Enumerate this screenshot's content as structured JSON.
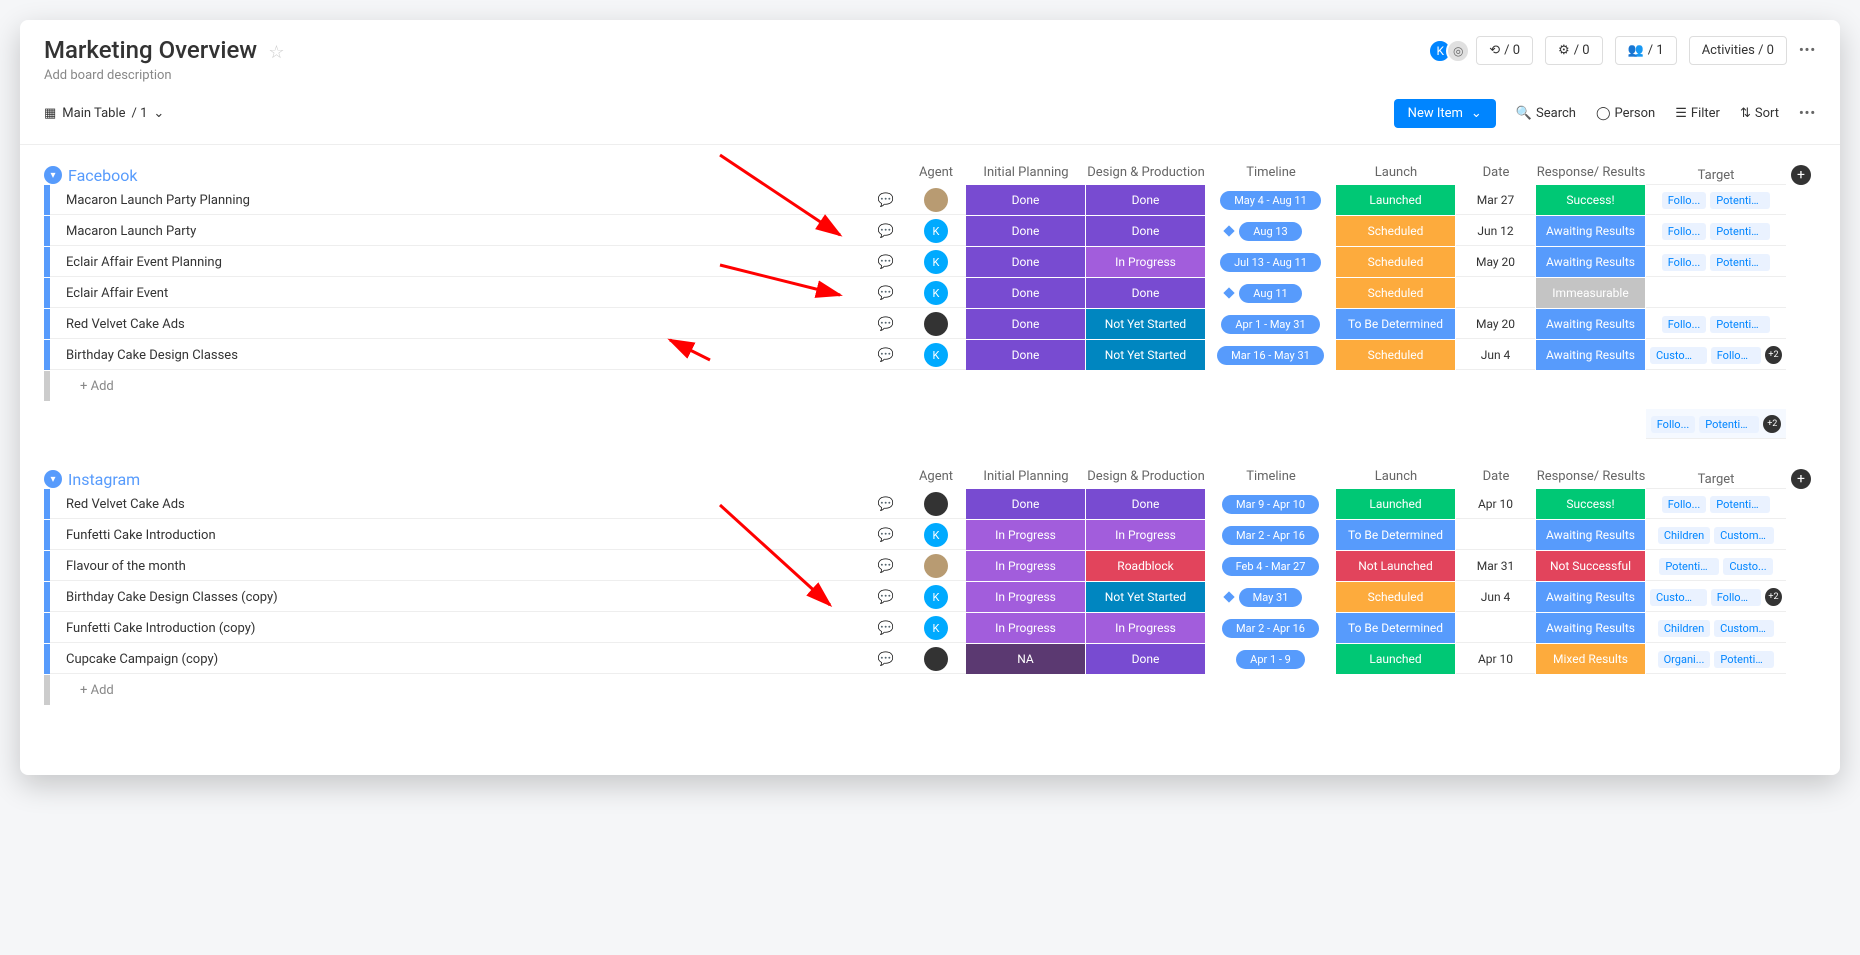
{
  "header": {
    "title": "Marketing Overview",
    "description_placeholder": "Add board description",
    "counters": {
      "llama": "/ 0",
      "robot": "/ 0",
      "invite": "/ 1"
    },
    "activities": "Activities / 0"
  },
  "toolbar": {
    "view_label": "Main Table",
    "view_count": "/ 1",
    "new_item": "New Item",
    "search": "Search",
    "person": "Person",
    "filter": "Filter",
    "sort": "Sort"
  },
  "columns": {
    "agent": "Agent",
    "initial_planning": "Initial Planning",
    "design_production": "Design & Production",
    "timeline": "Timeline",
    "launch": "Launch",
    "date": "Date",
    "response": "Response/ Results",
    "target": "Target"
  },
  "status_labels": {
    "done": "Done",
    "inprogress": "In Progress",
    "notstarted": "Not Yet Started",
    "roadblock": "Roadblock",
    "na": "NA",
    "launched": "Launched",
    "scheduled": "Scheduled",
    "tbd": "To Be Determined",
    "notlaunched": "Not Launched",
    "awaiting": "Awaiting Results",
    "success": "Success!",
    "immeasurable": "Immeasurable",
    "notsuccessful": "Not Successful",
    "mixed": "Mixed Results"
  },
  "groups": [
    {
      "name": "Facebook",
      "rows": [
        {
          "name": "Macaron Launch Party Planning",
          "agent": {
            "type": "img",
            "bg": "#b89b72",
            "label": ""
          },
          "initial": "done",
          "design": "done",
          "timeline": "May 4 - Aug 11",
          "diamond": false,
          "launch": "launched",
          "date": "Mar 27",
          "response": "success",
          "tags": [
            "Follo...",
            "Potential Foll..."
          ],
          "more": 0
        },
        {
          "name": "Macaron Launch Party",
          "agent": {
            "type": "k",
            "bg": "#00aaff",
            "label": "K"
          },
          "initial": "done",
          "design": "done",
          "timeline": "Aug 13",
          "diamond": true,
          "launch": "scheduled",
          "date": "Jun 12",
          "response": "awaiting",
          "tags": [
            "Follo...",
            "Potential Foll..."
          ],
          "more": 0
        },
        {
          "name": "Eclair Affair Event Planning",
          "agent": {
            "type": "k",
            "bg": "#00aaff",
            "label": "K"
          },
          "initial": "done",
          "design": "inprogress",
          "timeline": "Jul 13 - Aug 11",
          "diamond": false,
          "launch": "scheduled",
          "date": "May 20",
          "response": "awaiting",
          "tags": [
            "Follo...",
            "Potential Foll..."
          ],
          "more": 0
        },
        {
          "name": "Eclair Affair Event",
          "agent": {
            "type": "k",
            "bg": "#00aaff",
            "label": "K"
          },
          "initial": "done",
          "design": "done",
          "timeline": "Aug 11",
          "diamond": true,
          "launch": "scheduled",
          "date": "",
          "response": "immeasurable",
          "tags": [],
          "more": 0
        },
        {
          "name": "Red Velvet Cake Ads",
          "agent": {
            "type": "img",
            "bg": "#333",
            "label": ""
          },
          "initial": "done",
          "design": "notstarted",
          "timeline": "Apr 1 - May 31",
          "diamond": false,
          "launch": "tbd",
          "date": "May 20",
          "response": "awaiting",
          "tags": [
            "Follo...",
            "Potential Foll..."
          ],
          "more": 0
        },
        {
          "name": "Birthday Cake Design Classes",
          "agent": {
            "type": "k",
            "bg": "#00aaff",
            "label": "K"
          },
          "initial": "done",
          "design": "notstarted",
          "timeline": "Mar 16 - May 31",
          "diamond": false,
          "launch": "scheduled",
          "date": "Jun 4",
          "response": "awaiting",
          "tags": [
            "Custom...",
            "Follow..."
          ],
          "more": 2
        }
      ],
      "summary_tags": [
        "Follo...",
        "Potential F..."
      ],
      "summary_more": 2
    },
    {
      "name": "Instagram",
      "rows": [
        {
          "name": "Red Velvet Cake Ads",
          "agent": {
            "type": "img",
            "bg": "#333",
            "label": ""
          },
          "initial": "done",
          "design": "done",
          "timeline": "Mar 9 - Apr 10",
          "diamond": false,
          "launch": "launched",
          "date": "Apr 10",
          "response": "success",
          "tags": [
            "Follo...",
            "Potential Foll..."
          ],
          "more": 0
        },
        {
          "name": "Funfetti Cake Introduction",
          "agent": {
            "type": "k",
            "bg": "#00aaff",
            "label": "K"
          },
          "initial": "inprogress",
          "design": "inprogress",
          "timeline": "Mar 2 - Apr 16",
          "diamond": false,
          "launch": "tbd",
          "date": "",
          "response": "awaiting",
          "tags": [
            "Children",
            "Customers"
          ],
          "more": 0
        },
        {
          "name": "Flavour of the month",
          "agent": {
            "type": "img",
            "bg": "#b89b72",
            "label": ""
          },
          "initial": "inprogress",
          "design": "roadblock",
          "timeline": "Feb 4 - Mar 27",
          "diamond": false,
          "launch": "notlaunched",
          "date": "Mar 31",
          "response": "notsuccessful",
          "tags": [
            "Potential Fol...",
            "Custo..."
          ],
          "more": 0
        },
        {
          "name": "Birthday Cake Design Classes (copy)",
          "agent": {
            "type": "k",
            "bg": "#00aaff",
            "label": "K"
          },
          "initial": "inprogress",
          "design": "notstarted",
          "timeline": "May 31",
          "diamond": true,
          "launch": "scheduled",
          "date": "Jun 4",
          "response": "awaiting",
          "tags": [
            "Custom...",
            "Follow..."
          ],
          "more": 2
        },
        {
          "name": "Funfetti Cake Introduction (copy)",
          "agent": {
            "type": "k",
            "bg": "#00aaff",
            "label": "K"
          },
          "initial": "inprogress",
          "design": "inprogress",
          "timeline": "Mar 2 - Apr 16",
          "diamond": false,
          "launch": "tbd",
          "date": "",
          "response": "awaiting",
          "tags": [
            "Children",
            "Customers"
          ],
          "more": 0
        },
        {
          "name": "Cupcake Campaign (copy)",
          "agent": {
            "type": "img",
            "bg": "#333",
            "label": ""
          },
          "initial": "na",
          "design": "done",
          "timeline": "Apr 1 - 9",
          "diamond": false,
          "launch": "launched",
          "date": "Apr 10",
          "response": "mixed",
          "tags": [
            "Organi...",
            "Potential F..."
          ],
          "more": 0
        }
      ],
      "summary_tags": [],
      "summary_more": 0
    }
  ],
  "add_label": "+ Add"
}
